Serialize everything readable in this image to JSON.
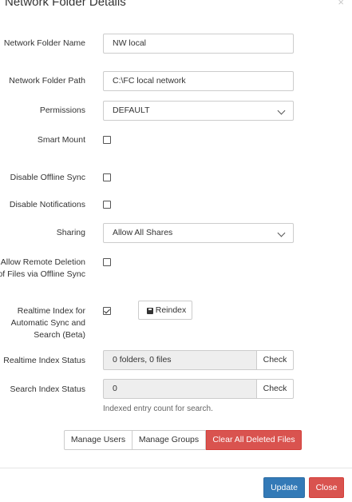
{
  "modal": {
    "title": "Network Folder Details",
    "close_glyph": "×"
  },
  "fields": {
    "folder_name_label": "Network Folder Name",
    "folder_name_value": "NW local",
    "folder_path_label": "Network Folder Path",
    "folder_path_value": "C:\\FC local network",
    "permissions_label": "Permissions",
    "permissions_value": "DEFAULT",
    "smart_mount_label": "Smart Mount",
    "smart_mount_checked": false,
    "disable_offline_sync_label": "Disable Offline Sync",
    "disable_offline_sync_checked": false,
    "disable_notifications_label": "Disable Notifications",
    "disable_notifications_checked": false,
    "sharing_label": "Sharing",
    "sharing_value": "Allow All Shares",
    "allow_remote_deletion_label": "Allow Remote Deletion of Files via Offline Sync",
    "allow_remote_deletion_checked": false,
    "realtime_index_label": "Realtime Index for Automatic Sync and Search (Beta)",
    "realtime_index_checked": true,
    "reindex_label": "Reindex",
    "realtime_index_status_label": "Realtime Index Status",
    "realtime_index_status_value": "0 folders, 0 files",
    "realtime_check_label": "Check",
    "search_index_status_label": "Search Index Status",
    "search_index_status_value": "0",
    "search_check_label": "Check",
    "search_index_help": "Indexed entry count for search."
  },
  "actions": {
    "manage_users": "Manage Users",
    "manage_groups": "Manage Groups",
    "clear_deleted": "Clear All Deleted Files"
  },
  "footer": {
    "update": "Update",
    "close": "Close"
  },
  "colors": {
    "primary": "#337ab7",
    "danger": "#d9534f",
    "readonly_bg": "#eeeeee",
    "border": "#cccccc"
  },
  "icons": {
    "close": "close-icon",
    "caret": "chevron-down-icon",
    "reindex": "reindex-icon"
  }
}
